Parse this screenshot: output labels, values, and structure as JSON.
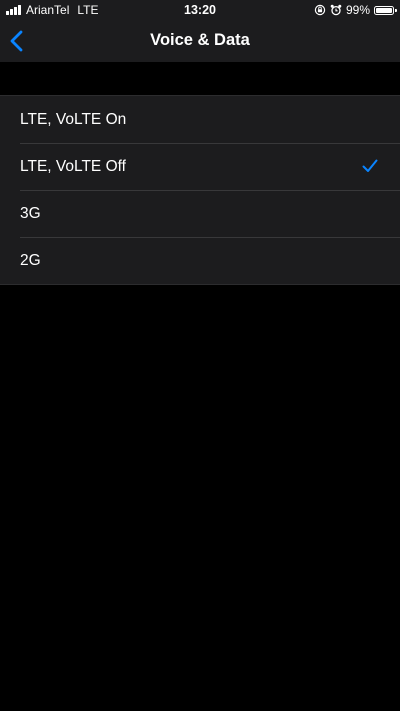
{
  "status_bar": {
    "carrier": "ArianTel",
    "network": "LTE",
    "time": "13:20",
    "battery_percent": "99%",
    "battery_level": 0.99,
    "icons": [
      "signal-icon",
      "orientation-lock-icon",
      "alarm-icon",
      "battery-icon"
    ]
  },
  "nav": {
    "title": "Voice & Data",
    "back_icon": "chevron-left-icon"
  },
  "options": [
    {
      "label": "LTE, VoLTE On",
      "selected": false
    },
    {
      "label": "LTE, VoLTE Off",
      "selected": true
    },
    {
      "label": "3G",
      "selected": false
    },
    {
      "label": "2G",
      "selected": false
    }
  ],
  "colors": {
    "accent": "#0a84ff",
    "background": "#000000",
    "cell_background": "#1c1c1e",
    "separator": "#38383a"
  }
}
